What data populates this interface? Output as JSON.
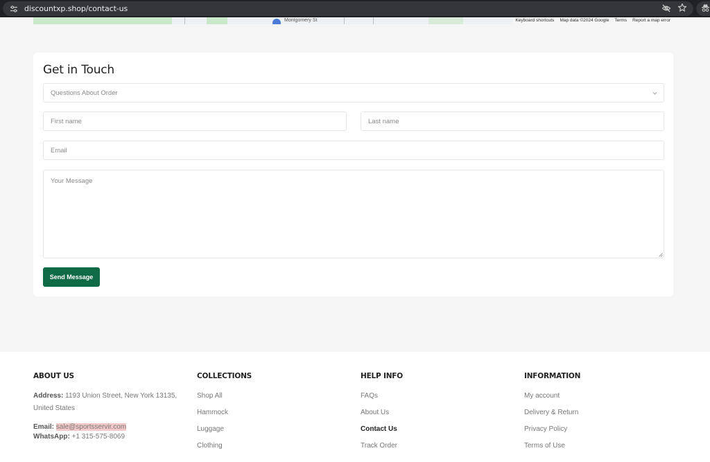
{
  "browser": {
    "url": "discountxp.shop/contact-us"
  },
  "map": {
    "place_label": "Montgomery St",
    "attribution": [
      "Keyboard shortcuts",
      "Map data ©2024 Google",
      "Terms",
      "Report a map error"
    ]
  },
  "form": {
    "title": "Get in Touch",
    "subject_select": {
      "value": "Questions About Order"
    },
    "first_name": {
      "placeholder": "First name"
    },
    "last_name": {
      "placeholder": "Last name"
    },
    "email": {
      "placeholder": "Email"
    },
    "message": {
      "placeholder": "Your Message"
    },
    "submit_label": "Send Message",
    "accent_color": "#0e6b45"
  },
  "footer": {
    "about": {
      "title": "ABOUT US",
      "address_label": "Address:",
      "address_line1": "1193 Union Street, New York 13135,",
      "address_line2": "United States",
      "email_label": "Email:",
      "email_value": "sale@sportsservir.com",
      "whatsapp_label": "WhatsApp:",
      "whatsapp_value": "+1 315-575-8069"
    },
    "collections": {
      "title": "COLLECTIONS",
      "links": [
        "Shop All",
        "Hammock",
        "Luggage",
        "Clothing"
      ]
    },
    "help": {
      "title": "HELP INFO",
      "links": [
        "FAQs",
        "About Us",
        "Contact Us",
        "Track Order"
      ],
      "active": "Contact Us"
    },
    "information": {
      "title": "INFORMATION",
      "links": [
        "My account",
        "Delivery & Return",
        "Privacy Policy",
        "Terms of Use"
      ]
    }
  }
}
